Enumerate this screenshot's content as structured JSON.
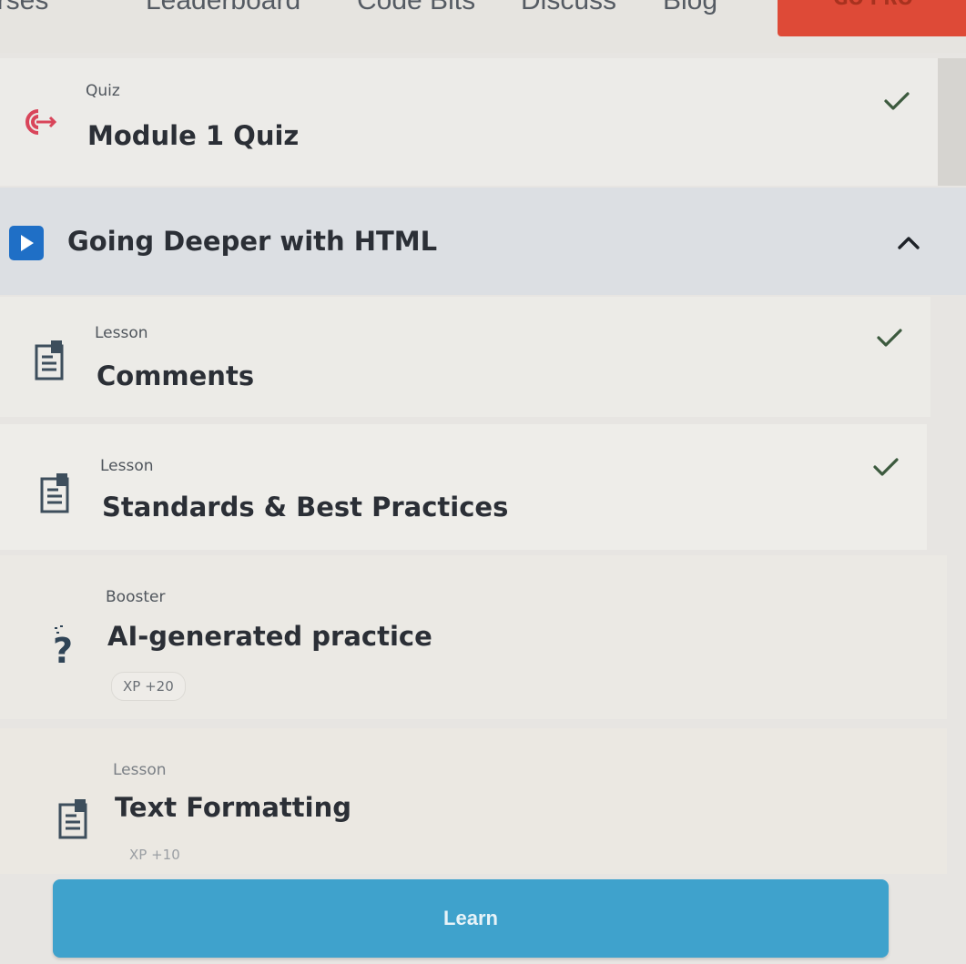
{
  "nav": {
    "items": [
      "arses",
      "Leaderboard",
      "Code Bits",
      "Discuss",
      "Blog"
    ],
    "cta_label": "GO PRO"
  },
  "quiz": {
    "type_label": "Quiz",
    "title": "Module 1 Quiz",
    "completed": true
  },
  "section": {
    "title": "Going Deeper with HTML",
    "expanded": true
  },
  "items": [
    {
      "type_label": "Lesson",
      "title": "Comments",
      "completed": true
    },
    {
      "type_label": "Lesson",
      "title": "Standards & Best Practices",
      "completed": true
    },
    {
      "type_label": "Booster",
      "title": "AI-generated practice",
      "xp": "XP +20",
      "completed": false
    },
    {
      "type_label": "Lesson",
      "title": "Text Formatting",
      "xp": "XP +10",
      "completed": false
    }
  ],
  "learn_button": "Learn",
  "colors": {
    "accent_blue": "#3fa2cc",
    "check_green": "#3c5a3e",
    "quiz_red": "#d9455a",
    "section_icon_blue": "#1f6fc6",
    "gopro_red": "#de4a37"
  }
}
